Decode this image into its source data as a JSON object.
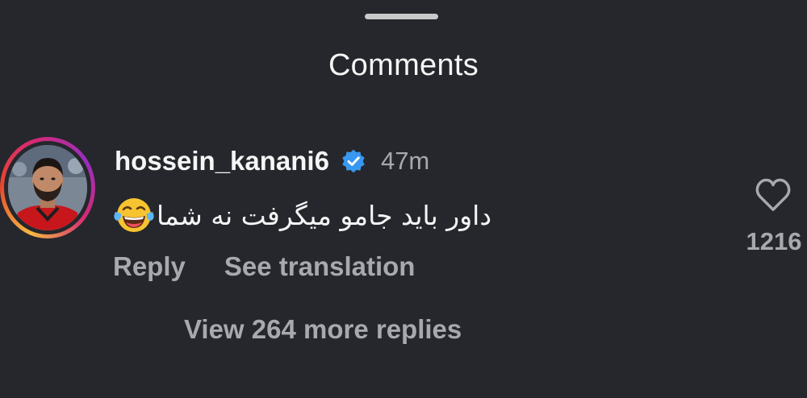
{
  "sheet": {
    "title": "Comments"
  },
  "comment": {
    "username": "hossein_kanani6",
    "verified": true,
    "timestamp": "47m",
    "text": "داور باید جامو میگرفت نه شما",
    "emoji": "face-with-tears-of-joy",
    "like_count": "1216",
    "reply_label": "Reply",
    "translate_label": "See translation",
    "view_replies_label": "View 264 more replies"
  },
  "colors": {
    "background": "#25272c",
    "primary_text": "#f5f5f5",
    "secondary_text": "#a8a8ad",
    "verified_blue": "#3897f0"
  }
}
